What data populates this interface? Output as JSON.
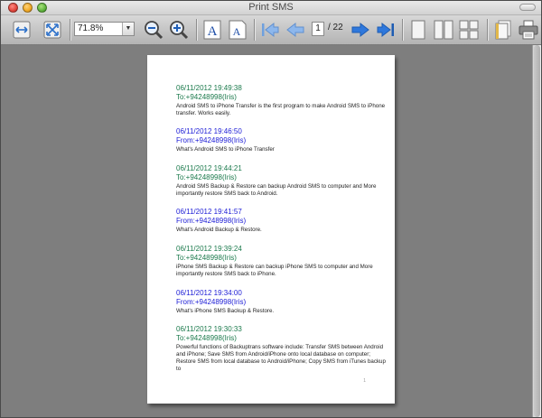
{
  "window": {
    "title": "Print SMS"
  },
  "toolbar": {
    "zoom_value": "71.8%",
    "current_page": "1",
    "page_total": "/ 22",
    "buttons": [
      "fit-width",
      "fit-page",
      "zoom-out",
      "zoom-in",
      "text-size-large",
      "text-size-small",
      "first-page",
      "previous-page",
      "next-page",
      "last-page",
      "single-page",
      "two-pages",
      "four-pages",
      "page-setup",
      "print"
    ]
  },
  "colors": {
    "sent": "#1b7a4c",
    "received": "#1c1cd6"
  },
  "page": {
    "page_number": "1",
    "messages": [
      {
        "timestamp": "06/11/2012 19:49:38",
        "contact": "To:+94248998(Iris)",
        "direction": "sent",
        "body": "Android SMS to iPhone Transfer is the first program to make Android SMS to iPhone transfer. Works easily."
      },
      {
        "timestamp": "06/11/2012 19:46:50",
        "contact": "From:+94248998(Iris)",
        "direction": "received",
        "body": "What's Android SMS to iPhone Transfer"
      },
      {
        "timestamp": "06/11/2012 19:44:21",
        "contact": "To:+94248998(Iris)",
        "direction": "sent",
        "body": "Android SMS Backup & Restore can backup Android SMS to computer and More importantly restore SMS back to Android."
      },
      {
        "timestamp": "06/11/2012 19:41:57",
        "contact": "From:+94248998(Iris)",
        "direction": "received",
        "body": "What's Android Backup & Restore."
      },
      {
        "timestamp": "06/11/2012 19:39:24",
        "contact": "To:+94248998(Iris)",
        "direction": "sent",
        "body": "iPhone SMS Backup & Restore can backup iPhone SMS to computer and More importantly restore SMS back to iPhone."
      },
      {
        "timestamp": "06/11/2012 19:34:00",
        "contact": "From:+94248998(Iris)",
        "direction": "received",
        "body": "What's iPhone SMS Backup & Restore."
      },
      {
        "timestamp": "06/11/2012 19:30:33",
        "contact": "To:+94248998(Iris)",
        "direction": "sent",
        "body": "Powerful functions of Backuptrans software include: Transfer SMS between Android and iPhone; Save SMS from Android/iPhone onto local database on computer; Restore SMS from local database to Android/iPhone; Copy SMS from iTunes backup to"
      }
    ]
  }
}
